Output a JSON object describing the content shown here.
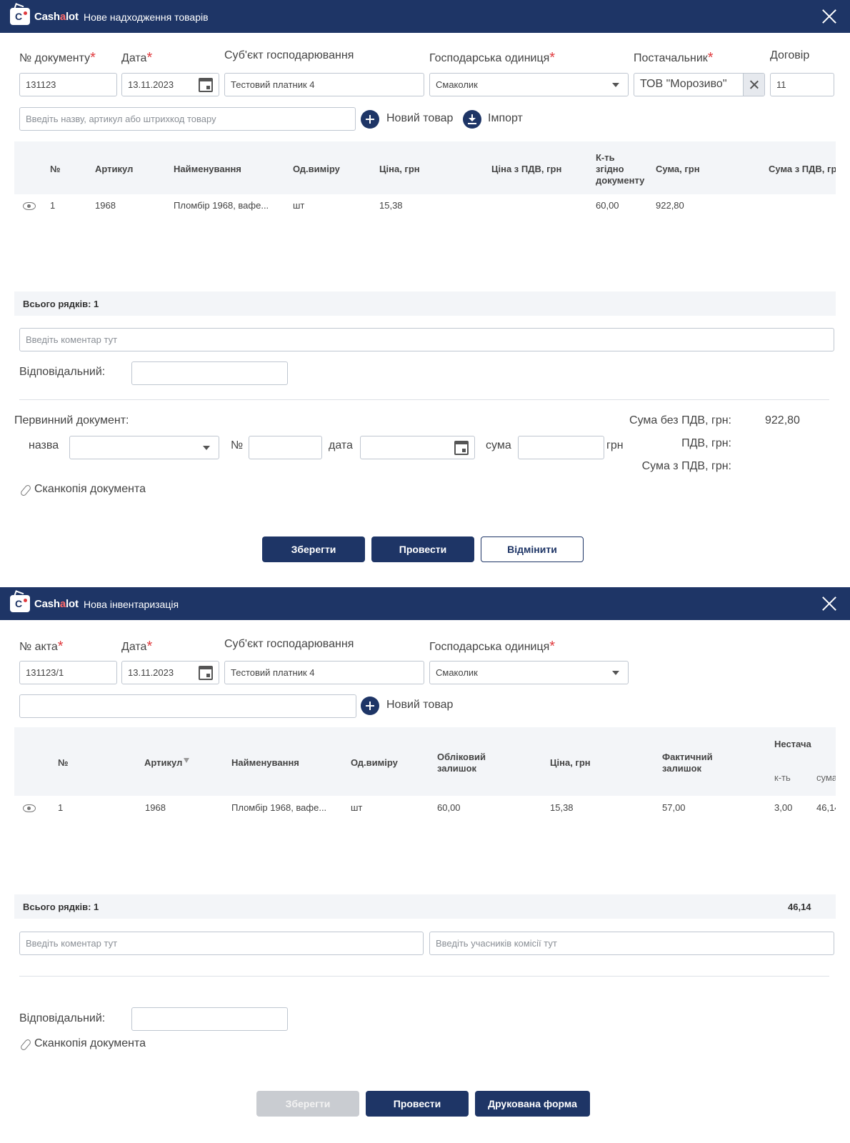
{
  "app": {
    "brand": "Cash",
    "brand_accent": "a",
    "brand_end": "lot"
  },
  "receipt": {
    "title": "Нове надходження товарів",
    "labels": {
      "doc_no": "№ документу",
      "date": "Дата",
      "entity": "Суб'єкт господарювання",
      "unit": "Господарська одиниця",
      "supplier": "Постачальник",
      "contract": "Договір"
    },
    "values": {
      "doc_no": "131123",
      "date": "13.11.2023",
      "entity": "Тестовий платник 4",
      "unit": "Смаколик",
      "supplier": "ТОВ \"Морозиво\"",
      "contract": "11"
    },
    "search_placeholder": "Введіть назву, артикул або штрихкод товару",
    "new_item": "Новий товар",
    "import": "Імпорт",
    "table": {
      "headers": {
        "no": "№",
        "article": "Артикул",
        "name": "Найменування",
        "uom": "Од.виміру",
        "price": "Ціна, грн",
        "price_vat": "Ціна з ПДВ, грн",
        "qty_l1": "К-ть",
        "qty_l2": "згідно",
        "qty_l3": "документу",
        "sum": "Сума, грн",
        "sum_vat": "Сума з ПДВ, грн"
      },
      "rows": [
        {
          "no": "1",
          "article": "1968",
          "name": "Пломбір 1968, вафе...",
          "uom": "шт",
          "price": "15,38",
          "qty": "60,00",
          "sum": "922,80"
        }
      ]
    },
    "total_rows": "Всього рядків: 1",
    "comment_placeholder": "Введіть коментар тут",
    "responsible": "Відповідальний:",
    "primary_doc": "Первинний документ:",
    "pd_name": "назва",
    "pd_no": "№",
    "pd_date": "дата",
    "pd_sum": "сума",
    "pd_currency": "грн",
    "scan": "Сканкопія документа",
    "sum_no_vat_label": "Сума без ПДВ, грн:",
    "sum_no_vat_value": "922,80",
    "vat_label": "ПДВ, грн:",
    "sum_vat_label": "Сума з ПДВ, грн:",
    "buttons": {
      "save": "Зберегти",
      "post": "Провести",
      "cancel": "Відмінити"
    }
  },
  "inventory": {
    "title": "Нова інвентаризація",
    "labels": {
      "act_no": "№ акта",
      "date": "Дата",
      "entity": "Суб'єкт господарювання",
      "unit": "Господарська одиниця"
    },
    "values": {
      "act_no": "131123/1",
      "date": "13.11.2023",
      "entity": "Тестовий платник 4",
      "unit": "Смаколик"
    },
    "new_item": "Новий товар",
    "table": {
      "headers": {
        "no": "№",
        "article": "Артикул",
        "name": "Найменування",
        "uom": "Од.виміру",
        "book_l1": "Обліковий",
        "book_l2": "залишок",
        "price": "Ціна, грн",
        "fact_l1": "Фактичний",
        "fact_l2": "залишок",
        "shortage": "Нестача",
        "shortage_qty": "к-ть",
        "shortage_sum": "сума"
      },
      "rows": [
        {
          "no": "1",
          "article": "1968",
          "name": "Пломбір 1968, вафе...",
          "uom": "шт",
          "book": "60,00",
          "price": "15,38",
          "fact": "57,00",
          "sh_qty": "3,00",
          "sh_sum": "46,14"
        }
      ]
    },
    "total_rows": "Всього рядків: 1",
    "total_sum": "46,14",
    "comment_placeholder": "Введіть коментар тут",
    "commission_placeholder": "Введіть учасників комісії тут",
    "responsible": "Відповідальний:",
    "scan": "Сканкопія документа",
    "buttons": {
      "save": "Зберегти",
      "post": "Провести",
      "print": "Друкована форма"
    }
  }
}
